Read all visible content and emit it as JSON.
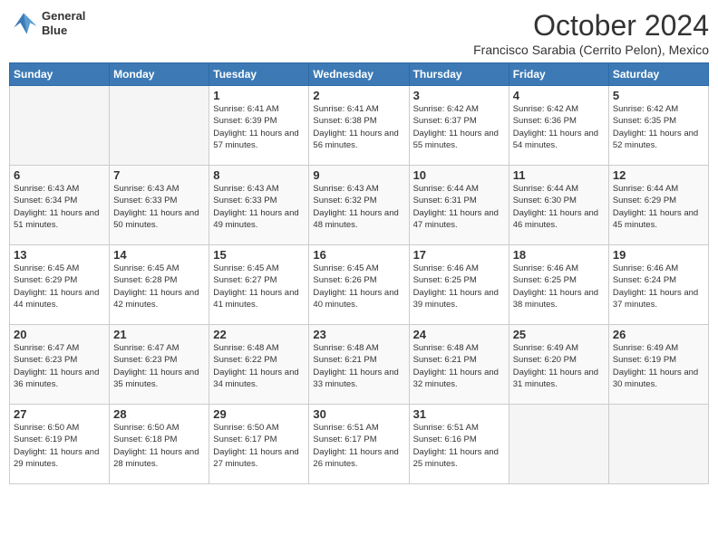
{
  "header": {
    "logo_line1": "General",
    "logo_line2": "Blue",
    "month": "October 2024",
    "location": "Francisco Sarabia (Cerrito Pelon), Mexico"
  },
  "weekdays": [
    "Sunday",
    "Monday",
    "Tuesday",
    "Wednesday",
    "Thursday",
    "Friday",
    "Saturday"
  ],
  "weeks": [
    [
      {
        "day": "",
        "empty": true
      },
      {
        "day": "",
        "empty": true
      },
      {
        "day": "1",
        "sunrise": "Sunrise: 6:41 AM",
        "sunset": "Sunset: 6:39 PM",
        "daylight": "Daylight: 11 hours and 57 minutes."
      },
      {
        "day": "2",
        "sunrise": "Sunrise: 6:41 AM",
        "sunset": "Sunset: 6:38 PM",
        "daylight": "Daylight: 11 hours and 56 minutes."
      },
      {
        "day": "3",
        "sunrise": "Sunrise: 6:42 AM",
        "sunset": "Sunset: 6:37 PM",
        "daylight": "Daylight: 11 hours and 55 minutes."
      },
      {
        "day": "4",
        "sunrise": "Sunrise: 6:42 AM",
        "sunset": "Sunset: 6:36 PM",
        "daylight": "Daylight: 11 hours and 54 minutes."
      },
      {
        "day": "5",
        "sunrise": "Sunrise: 6:42 AM",
        "sunset": "Sunset: 6:35 PM",
        "daylight": "Daylight: 11 hours and 52 minutes."
      }
    ],
    [
      {
        "day": "6",
        "sunrise": "Sunrise: 6:43 AM",
        "sunset": "Sunset: 6:34 PM",
        "daylight": "Daylight: 11 hours and 51 minutes."
      },
      {
        "day": "7",
        "sunrise": "Sunrise: 6:43 AM",
        "sunset": "Sunset: 6:33 PM",
        "daylight": "Daylight: 11 hours and 50 minutes."
      },
      {
        "day": "8",
        "sunrise": "Sunrise: 6:43 AM",
        "sunset": "Sunset: 6:33 PM",
        "daylight": "Daylight: 11 hours and 49 minutes."
      },
      {
        "day": "9",
        "sunrise": "Sunrise: 6:43 AM",
        "sunset": "Sunset: 6:32 PM",
        "daylight": "Daylight: 11 hours and 48 minutes."
      },
      {
        "day": "10",
        "sunrise": "Sunrise: 6:44 AM",
        "sunset": "Sunset: 6:31 PM",
        "daylight": "Daylight: 11 hours and 47 minutes."
      },
      {
        "day": "11",
        "sunrise": "Sunrise: 6:44 AM",
        "sunset": "Sunset: 6:30 PM",
        "daylight": "Daylight: 11 hours and 46 minutes."
      },
      {
        "day": "12",
        "sunrise": "Sunrise: 6:44 AM",
        "sunset": "Sunset: 6:29 PM",
        "daylight": "Daylight: 11 hours and 45 minutes."
      }
    ],
    [
      {
        "day": "13",
        "sunrise": "Sunrise: 6:45 AM",
        "sunset": "Sunset: 6:29 PM",
        "daylight": "Daylight: 11 hours and 44 minutes."
      },
      {
        "day": "14",
        "sunrise": "Sunrise: 6:45 AM",
        "sunset": "Sunset: 6:28 PM",
        "daylight": "Daylight: 11 hours and 42 minutes."
      },
      {
        "day": "15",
        "sunrise": "Sunrise: 6:45 AM",
        "sunset": "Sunset: 6:27 PM",
        "daylight": "Daylight: 11 hours and 41 minutes."
      },
      {
        "day": "16",
        "sunrise": "Sunrise: 6:45 AM",
        "sunset": "Sunset: 6:26 PM",
        "daylight": "Daylight: 11 hours and 40 minutes."
      },
      {
        "day": "17",
        "sunrise": "Sunrise: 6:46 AM",
        "sunset": "Sunset: 6:25 PM",
        "daylight": "Daylight: 11 hours and 39 minutes."
      },
      {
        "day": "18",
        "sunrise": "Sunrise: 6:46 AM",
        "sunset": "Sunset: 6:25 PM",
        "daylight": "Daylight: 11 hours and 38 minutes."
      },
      {
        "day": "19",
        "sunrise": "Sunrise: 6:46 AM",
        "sunset": "Sunset: 6:24 PM",
        "daylight": "Daylight: 11 hours and 37 minutes."
      }
    ],
    [
      {
        "day": "20",
        "sunrise": "Sunrise: 6:47 AM",
        "sunset": "Sunset: 6:23 PM",
        "daylight": "Daylight: 11 hours and 36 minutes."
      },
      {
        "day": "21",
        "sunrise": "Sunrise: 6:47 AM",
        "sunset": "Sunset: 6:23 PM",
        "daylight": "Daylight: 11 hours and 35 minutes."
      },
      {
        "day": "22",
        "sunrise": "Sunrise: 6:48 AM",
        "sunset": "Sunset: 6:22 PM",
        "daylight": "Daylight: 11 hours and 34 minutes."
      },
      {
        "day": "23",
        "sunrise": "Sunrise: 6:48 AM",
        "sunset": "Sunset: 6:21 PM",
        "daylight": "Daylight: 11 hours and 33 minutes."
      },
      {
        "day": "24",
        "sunrise": "Sunrise: 6:48 AM",
        "sunset": "Sunset: 6:21 PM",
        "daylight": "Daylight: 11 hours and 32 minutes."
      },
      {
        "day": "25",
        "sunrise": "Sunrise: 6:49 AM",
        "sunset": "Sunset: 6:20 PM",
        "daylight": "Daylight: 11 hours and 31 minutes."
      },
      {
        "day": "26",
        "sunrise": "Sunrise: 6:49 AM",
        "sunset": "Sunset: 6:19 PM",
        "daylight": "Daylight: 11 hours and 30 minutes."
      }
    ],
    [
      {
        "day": "27",
        "sunrise": "Sunrise: 6:50 AM",
        "sunset": "Sunset: 6:19 PM",
        "daylight": "Daylight: 11 hours and 29 minutes."
      },
      {
        "day": "28",
        "sunrise": "Sunrise: 6:50 AM",
        "sunset": "Sunset: 6:18 PM",
        "daylight": "Daylight: 11 hours and 28 minutes."
      },
      {
        "day": "29",
        "sunrise": "Sunrise: 6:50 AM",
        "sunset": "Sunset: 6:17 PM",
        "daylight": "Daylight: 11 hours and 27 minutes."
      },
      {
        "day": "30",
        "sunrise": "Sunrise: 6:51 AM",
        "sunset": "Sunset: 6:17 PM",
        "daylight": "Daylight: 11 hours and 26 minutes."
      },
      {
        "day": "31",
        "sunrise": "Sunrise: 6:51 AM",
        "sunset": "Sunset: 6:16 PM",
        "daylight": "Daylight: 11 hours and 25 minutes."
      },
      {
        "day": "",
        "empty": true
      },
      {
        "day": "",
        "empty": true
      }
    ]
  ]
}
